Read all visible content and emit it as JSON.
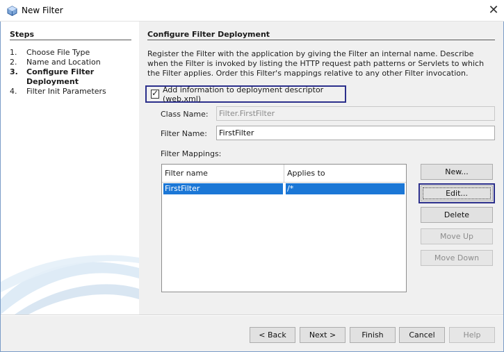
{
  "window": {
    "title": "New Filter",
    "close_glyph": "✕",
    "icon": "netbeans-cube-icon"
  },
  "steps": {
    "title": "Steps",
    "items": [
      {
        "num": "1.",
        "label": "Choose File Type",
        "current": false
      },
      {
        "num": "2.",
        "label": "Name and Location",
        "current": false
      },
      {
        "num": "3.",
        "label": "Configure Filter Deployment",
        "current": true
      },
      {
        "num": "4.",
        "label": "Filter Init Parameters",
        "current": false
      }
    ]
  },
  "main": {
    "title": "Configure Filter Deployment",
    "description": "Register the Filter with the application by giving the Filter an internal name. Describe when the Filter is invoked by listing the HTTP request path patterns or Servlets to which the Filter applies. Order this Filter's mappings relative to any other Filter invocation.",
    "add_info_checkbox": {
      "label": "Add information to deployment descriptor (web.xml)",
      "checked": true
    },
    "class_name": {
      "label": "Class Name:",
      "value": "Filter.FirstFilter"
    },
    "filter_name": {
      "label": "Filter Name:",
      "value": "FirstFilter"
    },
    "mappings_label": "Filter Mappings:",
    "table": {
      "headers": [
        "Filter name",
        "Applies to"
      ],
      "rows": [
        {
          "filter_name": "FirstFilter",
          "applies_to": "/*"
        }
      ]
    },
    "buttons": {
      "new": "New...",
      "edit": "Edit...",
      "delete": "Delete",
      "move_up": "Move Up",
      "move_down": "Move Down"
    }
  },
  "footer": {
    "back": "< Back",
    "next": "Next >",
    "finish": "Finish",
    "cancel": "Cancel",
    "help": "Help"
  },
  "colors": {
    "selection": "#1b77d6",
    "focus_outline": "#2b2f8b",
    "panel_bg": "#f0f0f0"
  }
}
